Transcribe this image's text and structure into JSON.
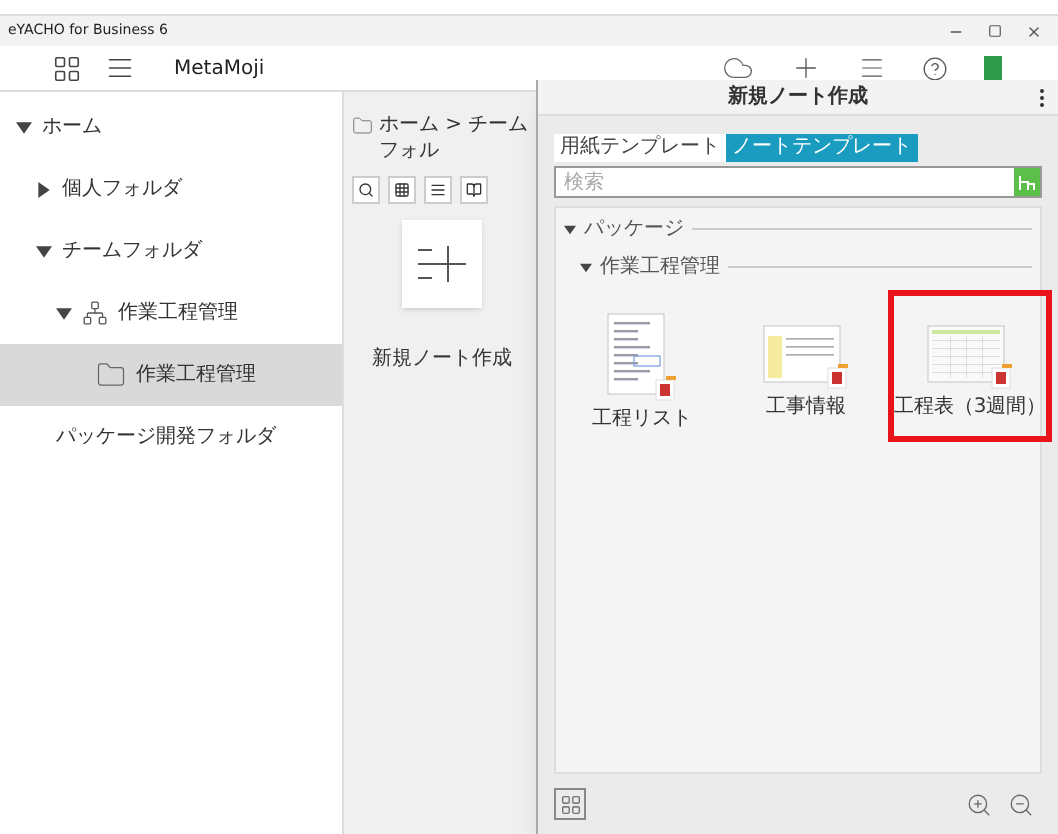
{
  "window": {
    "title": "eYACHO for Business 6"
  },
  "toolbar": {
    "account": "MetaMoji"
  },
  "sidebar": {
    "items": [
      {
        "label": "ホーム",
        "kind": "node",
        "expanded": true,
        "selected": false,
        "children": [
          {
            "label": "個人フォルダ",
            "kind": "node",
            "expanded": false,
            "selected": false
          },
          {
            "label": "チームフォルダ",
            "kind": "node",
            "expanded": true,
            "selected": false,
            "children": [
              {
                "label": "作業工程管理",
                "kind": "team",
                "expanded": true,
                "selected": false,
                "children": [
                  {
                    "label": "作業工程管理",
                    "kind": "folder",
                    "selected": true
                  }
                ]
              }
            ]
          },
          {
            "label": "パッケージ開発フォルダ",
            "kind": "plain",
            "selected": false
          }
        ]
      }
    ]
  },
  "main": {
    "breadcrumb": "ホーム > チームフォル",
    "new_note": {
      "label": "新規ノート作成"
    }
  },
  "dialog": {
    "title": "新規ノート作成",
    "tabs": [
      {
        "label": "用紙テンプレート",
        "selected": false
      },
      {
        "label": "ノートテンプレート",
        "selected": true
      }
    ],
    "search": {
      "placeholder": "検索"
    },
    "sections": [
      {
        "label": "パッケージ",
        "expanded": true,
        "children": [
          {
            "label": "作業工程管理",
            "expanded": true,
            "templates": [
              {
                "label": "工程リスト",
                "kind": "list",
                "selected": false
              },
              {
                "label": "工事情報",
                "kind": "form",
                "selected": false
              },
              {
                "label": "工程表（3週間）",
                "kind": "chart",
                "selected": true
              }
            ]
          }
        ]
      }
    ]
  }
}
